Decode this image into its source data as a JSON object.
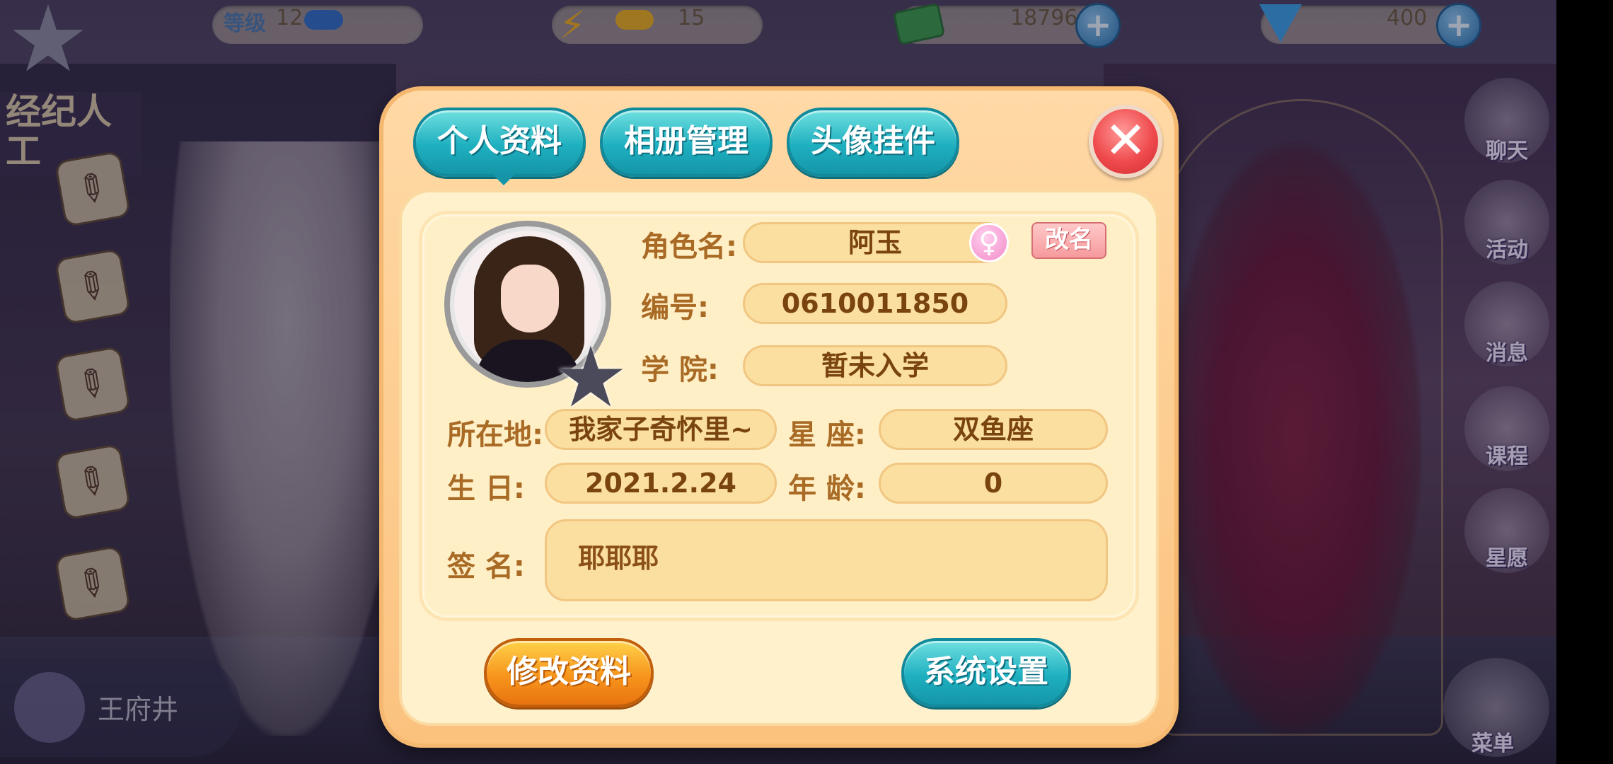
{
  "hud": {
    "level_label": "等级",
    "level_value": "12",
    "level_progress": 0.36,
    "energy_value": "15",
    "energy_progress": 0.35,
    "cash_value": "18796",
    "diamond_value": "400"
  },
  "left_panel": {
    "sign_partial": "经纪人\n工",
    "location": "王府井"
  },
  "right_menu": {
    "chat": "聊天",
    "activity": "活动",
    "message": "消息",
    "course": "课程",
    "wish": "星愿",
    "menu": "菜单"
  },
  "modal": {
    "tabs": [
      "个人资料",
      "相册管理",
      "头像挂件"
    ],
    "active_tab": 0,
    "close_glyph": "✕",
    "fields": {
      "role_name_label": "角色名:",
      "role_name_value": "阿玉",
      "gender_glyph": "♀",
      "rename_button": "改名",
      "id_label": "编号:",
      "id_value": "0610011850",
      "college_label": "学  院:",
      "college_value": "暂未入学",
      "location_label": "所在地:",
      "location_value": "我家子奇怀里~",
      "constellation_label": "星  座:",
      "constellation_value": "双鱼座",
      "birthday_label": "生  日:",
      "birthday_value": "2021.2.24",
      "age_label": "年  龄:",
      "age_value": "0",
      "signature_label": "签  名:",
      "signature_value": "耶耶耶"
    },
    "buttons": {
      "edit": "修改资料",
      "settings": "系统设置"
    }
  },
  "icons": {
    "star": "★",
    "plus": "+",
    "pencil": "✎"
  }
}
